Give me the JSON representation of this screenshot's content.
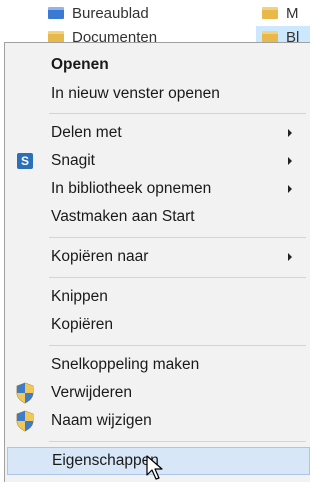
{
  "background": {
    "row1_label": "Bureaublad",
    "row2_label": "Documenten",
    "right_label": "M",
    "right_label2": "Bl"
  },
  "menu": {
    "items": [
      {
        "label": "Openen",
        "bold": true,
        "icon": null,
        "submenu": false
      },
      {
        "label": "In nieuw venster openen",
        "bold": false,
        "icon": null,
        "submenu": false
      },
      {
        "label": "Delen met",
        "bold": false,
        "icon": null,
        "submenu": true
      },
      {
        "label": "Snagit",
        "bold": false,
        "icon": "snagit-icon",
        "submenu": true
      },
      {
        "label": "In bibliotheek opnemen",
        "bold": false,
        "icon": null,
        "submenu": true
      },
      {
        "label": "Vastmaken aan Start",
        "bold": false,
        "icon": null,
        "submenu": false
      },
      {
        "label": "Kopiëren naar",
        "bold": false,
        "icon": null,
        "submenu": true
      },
      {
        "label": "Knippen",
        "bold": false,
        "icon": null,
        "submenu": false
      },
      {
        "label": "Kopiëren",
        "bold": false,
        "icon": null,
        "submenu": false
      },
      {
        "label": "Snelkoppeling maken",
        "bold": false,
        "icon": null,
        "submenu": false
      },
      {
        "label": "Verwijderen",
        "bold": false,
        "icon": "uac-shield-icon",
        "submenu": false
      },
      {
        "label": "Naam wijzigen",
        "bold": false,
        "icon": "uac-shield-icon",
        "submenu": false
      },
      {
        "label": "Eigenschappen",
        "bold": false,
        "icon": null,
        "submenu": false,
        "hovered": true
      }
    ],
    "snagit_glyph": "S"
  },
  "colors": {
    "menu_bg": "#f2f2f2",
    "hover_bg": "#d7e7f7",
    "hover_border": "#a9c6e8"
  }
}
